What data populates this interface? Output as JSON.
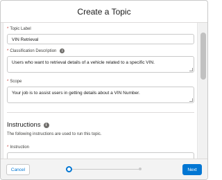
{
  "modal": {
    "title": "Create a Topic"
  },
  "form": {
    "topic_label": {
      "label": "Topic Label",
      "value": "VIN Retrieval"
    },
    "classification_description": {
      "label": "Classification Description",
      "value": "Users who want to retrieval details of a vehicle related to a specific VIN."
    },
    "scope": {
      "label": "Scope",
      "value": "Your job is to assist users in getting details about a VIN Number."
    },
    "instructions_section": {
      "title": "Instructions",
      "description": "The following instructions are used to run this topic."
    },
    "instruction": {
      "label": "Instruction"
    }
  },
  "footer": {
    "cancel_label": "Cancel",
    "next_label": "Next",
    "progress": {
      "current_step": 1,
      "total_steps": 2
    }
  },
  "colors": {
    "brand": "#0176d3",
    "required": "#c23934"
  },
  "icons": {
    "info": "info-icon"
  }
}
